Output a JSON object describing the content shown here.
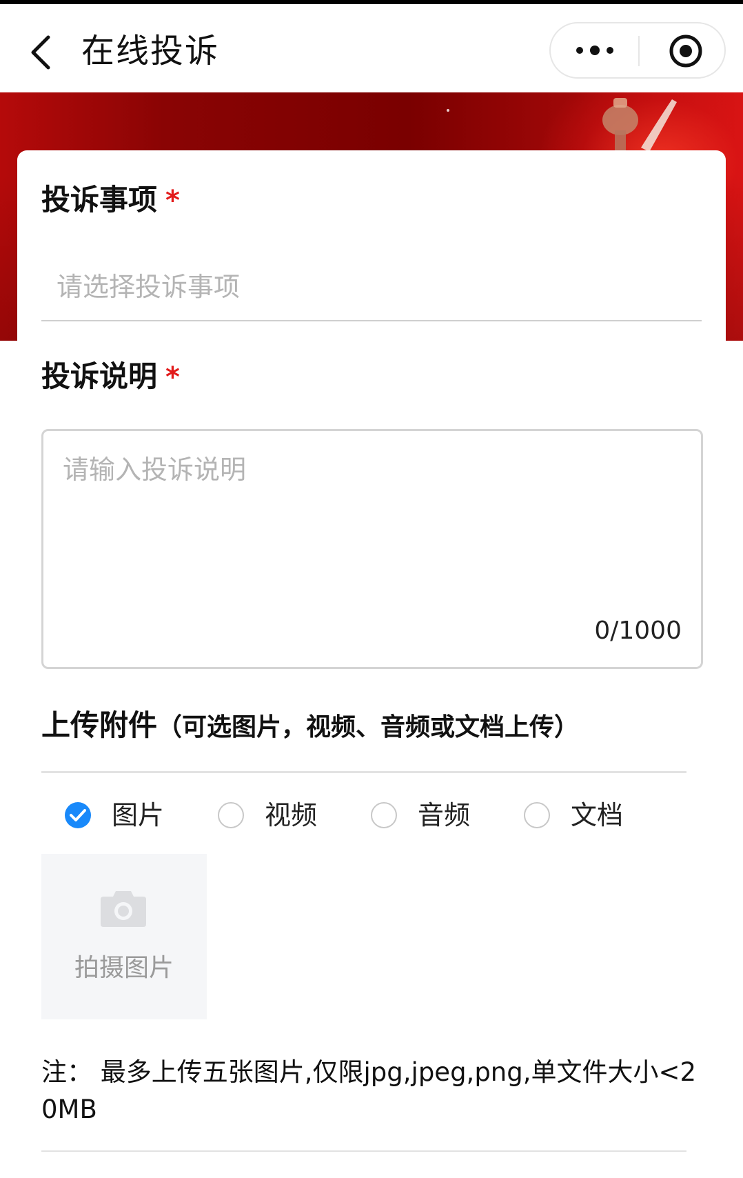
{
  "nav": {
    "title": "在线投诉",
    "icons": {
      "back": "chevron-left-icon",
      "more": "more-dots-icon",
      "close": "target-circle-icon"
    }
  },
  "form": {
    "item_label": "投诉事项",
    "item_placeholder": "请选择投诉事项",
    "desc_label": "投诉说明",
    "desc_placeholder": "请输入投诉说明",
    "char_count": "0/1000",
    "required_mark": "*",
    "upload_title": "上传附件",
    "upload_hint": "（可选图片，视频、音频或文档上传）",
    "attachment_types": [
      {
        "label": "图片",
        "checked": true
      },
      {
        "label": "视频",
        "checked": false
      },
      {
        "label": "音频",
        "checked": false
      },
      {
        "label": "文档",
        "checked": false
      }
    ],
    "photo_label": "拍摄图片",
    "note": "注：  最多上传五张图片,仅限jpg,jpeg,png,单文件大小<20MB"
  },
  "colors": {
    "accent": "#1989fa",
    "required": "#e21b1b",
    "banner": "#7a0000"
  }
}
